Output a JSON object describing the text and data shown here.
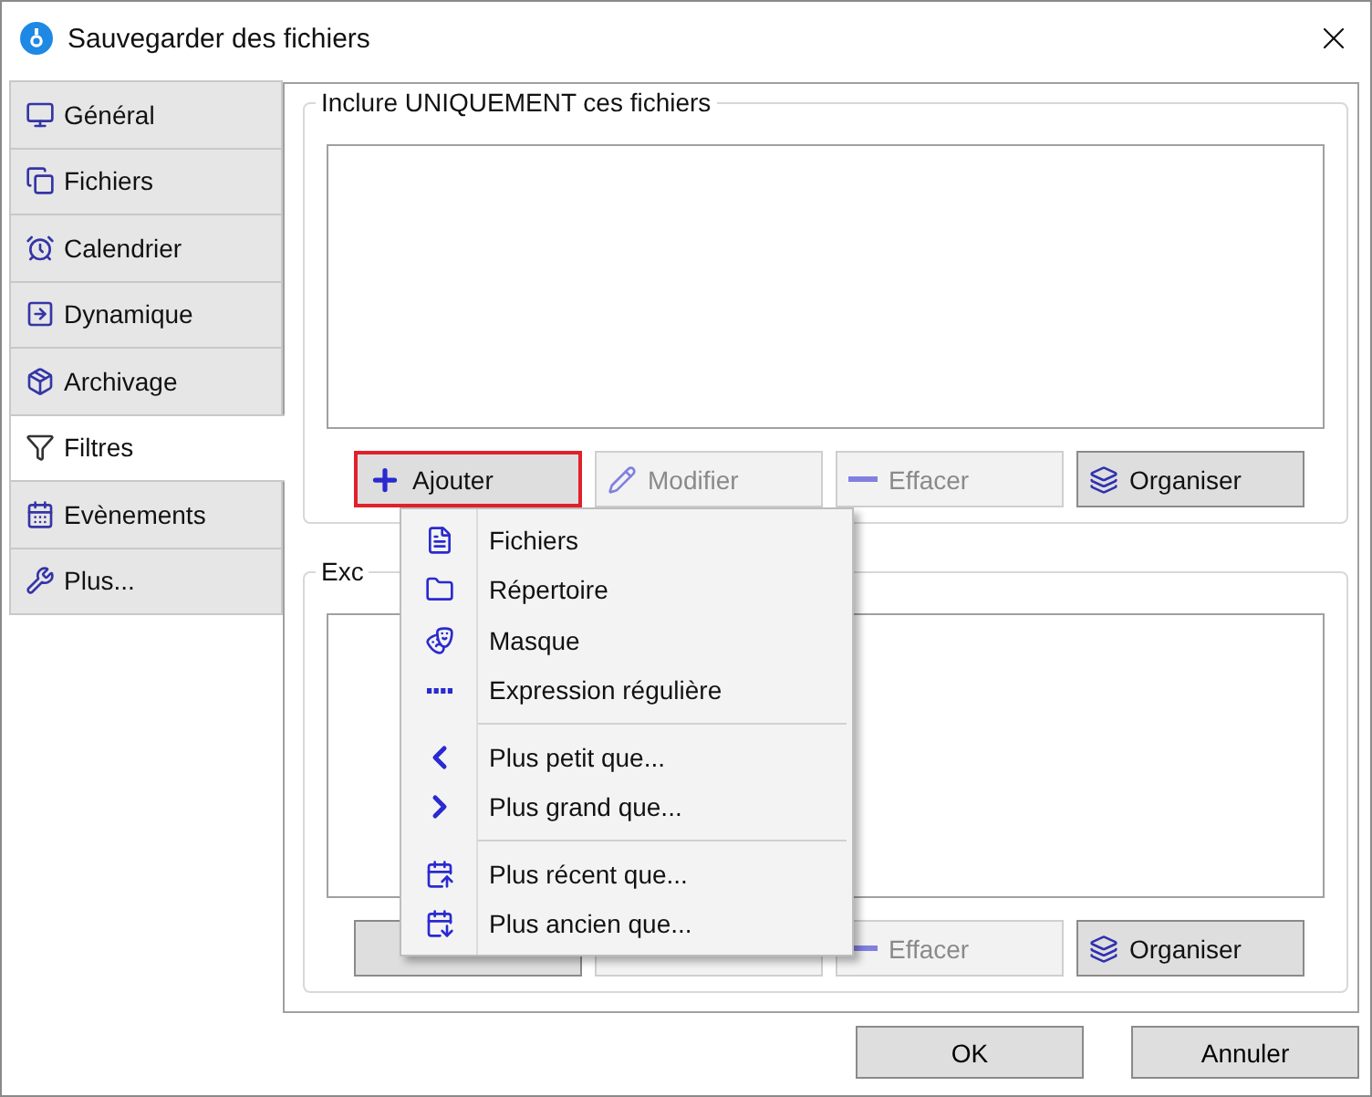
{
  "window": {
    "title": "Sauvegarder des fichiers"
  },
  "sidebar": {
    "items": [
      {
        "label": "Général",
        "selected": false
      },
      {
        "label": "Fichiers",
        "selected": false
      },
      {
        "label": "Calendrier",
        "selected": false
      },
      {
        "label": "Dynamique",
        "selected": false
      },
      {
        "label": "Archivage",
        "selected": false
      },
      {
        "label": "Filtres",
        "selected": true
      },
      {
        "label": "Evènements",
        "selected": false
      },
      {
        "label": "Plus...",
        "selected": false
      }
    ]
  },
  "include_group": {
    "title": "Inclure UNIQUEMENT ces fichiers",
    "buttons": [
      {
        "label": "Ajouter",
        "disabled": false,
        "focused": true
      },
      {
        "label": "Modifier",
        "disabled": true,
        "focused": false
      },
      {
        "label": "Effacer",
        "disabled": true,
        "focused": false
      },
      {
        "label": "Organiser",
        "disabled": false,
        "focused": false
      }
    ]
  },
  "exclude_group": {
    "title": "Exc",
    "buttons": [
      {
        "disabled": false,
        "focused": false
      },
      {
        "disabled": true,
        "focused": false
      },
      {
        "label": "Effacer",
        "disabled": true,
        "focused": false
      },
      {
        "label": "Organiser",
        "disabled": false,
        "focused": false
      }
    ]
  },
  "add_menu": {
    "sections": [
      {
        "items": [
          {
            "label": "Fichiers"
          },
          {
            "label": "Répertoire"
          },
          {
            "label": "Masque"
          },
          {
            "label": "Expression régulière"
          }
        ]
      },
      {
        "items": [
          {
            "label": "Plus petit que..."
          },
          {
            "label": "Plus grand que..."
          }
        ]
      },
      {
        "items": [
          {
            "label": "Plus récent que..."
          },
          {
            "label": "Plus ancien que..."
          }
        ]
      }
    ]
  },
  "buttons": [
    "OK",
    "Annuler"
  ]
}
